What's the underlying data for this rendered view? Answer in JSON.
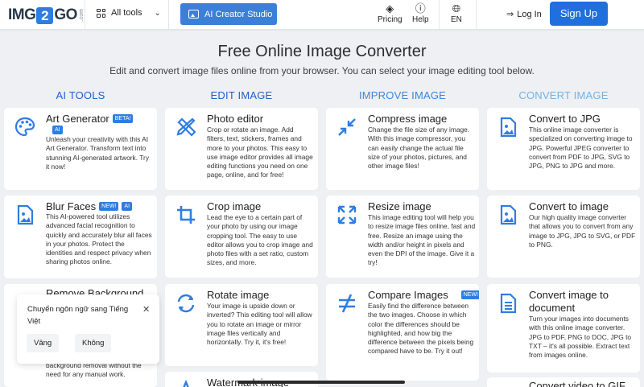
{
  "header": {
    "logo_left": "IMG",
    "logo_mid": "2",
    "logo_right": "GO",
    "logo_suffix": ".com",
    "all_tools": "All tools",
    "ai_studio": "AI Creator Studio",
    "pricing": "Pricing",
    "help": "Help",
    "language": "EN",
    "login": "Log In",
    "signup": "Sign Up"
  },
  "hero": {
    "title": "Free Online Image Converter",
    "subtitle": "Edit and convert image files online from your browser. You can select your image editing tool below."
  },
  "columns": {
    "ai": "AI TOOLS",
    "edit": "EDIT IMAGE",
    "improve": "IMPROVE IMAGE",
    "convert": "CONVERT IMAGE"
  },
  "tools": {
    "art": {
      "title": "Art Generator",
      "badge": "BETA!",
      "badge2": "AI",
      "desc": "Unleash your creativity with this AI Art Generator. Transform text into stunning AI-generated artwork. Try it now!"
    },
    "blur": {
      "title": "Blur Faces",
      "badge": "NEW!",
      "badge2": "AI",
      "desc": "This AI-powered tool utilizes advanced facial recognition to quickly and accurately blur all faces in your photos. Protect the identities and respect privacy when sharing photos online."
    },
    "bg": {
      "title": "Remove Background",
      "desc": "background removal without the need for any manual work."
    },
    "photo": {
      "title": "Photo editor",
      "desc": "Crop or rotate an image. Add filters, text, stickers, frames and more to your photos. This easy to use image editor provides all image editing functions you need on one page, online, and for free!"
    },
    "crop": {
      "title": "Crop image",
      "desc": "Lead the eye to a certain part of your photo by using our image cropping tool. The easy to use editor allows you to crop image and photo files with a set ratio, custom sizes, and more."
    },
    "rotate": {
      "title": "Rotate image",
      "desc": "Your image is upside down or inverted? This editing tool will allow you to rotate an image or mirror image files vertically and horizontally. Try it, it's free!"
    },
    "watermark": {
      "title": "Watermark image"
    },
    "compress": {
      "title": "Compress image",
      "desc": "Change the file size of any image. With this image compressor, you can easily change the actual file size of your photos, pictures, and other image files!"
    },
    "resize": {
      "title": "Resize image",
      "desc": "This image editing tool will help you to resize image files online, fast and free. Resize an image using the width and/or height in pixels and even the DPI of the image. Give it a try!"
    },
    "compare": {
      "title": "Compare Images",
      "badge": "NEW!",
      "desc": "Easily find the difference between the two images. Choose in which color the differences should be highlighted, and how big the difference between the pixels being compared have to be. Try it out!"
    },
    "jpg": {
      "title": "Convert to JPG",
      "desc": "This online image converter is specialized on converting image to JPG. Powerful JPEG converter to convert from PDF to JPG, SVG to JPG, PNG to JPG and more."
    },
    "toimage": {
      "title": "Convert to image",
      "desc": "Our high quality image converter that allows you to convert from any image to JPG, JPG to SVG, or PDF to PNG."
    },
    "todoc": {
      "title": "Convert image to document",
      "desc": "Turn your images into documents with this online image converter. JPG to PDF, PNG to DOC, JPG to TXT – it's all possible. Extract text from images online."
    },
    "gif": {
      "title": "Convert video to GIF"
    }
  },
  "popup": {
    "message": "Chuyển ngôn ngữ sang Tiếng Việt",
    "yes": "Vâng",
    "no": "Không"
  },
  "colors": {
    "primary": "#1f6fdc",
    "icon_blue": "#2f7de1",
    "page_bg": "#eef0f3"
  }
}
